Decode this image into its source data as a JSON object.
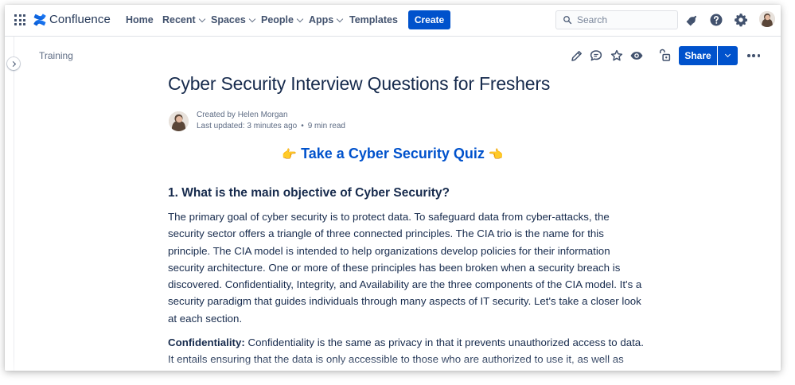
{
  "app": {
    "name": "Confluence"
  },
  "nav": {
    "items": [
      {
        "label": "Home",
        "dropdown": false
      },
      {
        "label": "Recent",
        "dropdown": true
      },
      {
        "label": "Spaces",
        "dropdown": true
      },
      {
        "label": "People",
        "dropdown": true
      },
      {
        "label": "Apps",
        "dropdown": true
      },
      {
        "label": "Templates",
        "dropdown": false
      }
    ],
    "create_label": "Create",
    "search_placeholder": "Search"
  },
  "breadcrumb": "Training",
  "page": {
    "title": "Cyber Security Interview Questions for Freshers",
    "created_by": "Created by Helen Morgan",
    "last_updated": "Last updated: 3 minutes ago",
    "separator": "•",
    "read_time": "9 min read",
    "quiz_link": "Take a Cyber Security Quiz",
    "quiz_left_emoji": "👉",
    "quiz_right_emoji": "👈",
    "question_heading": "1. What is the main objective of Cyber Security?",
    "paragraph1": "The primary goal of cyber security is to protect data. To safeguard data from cyber-attacks, the security sector offers a triangle of three connected principles. The CIA trio is the name for this principle. The CIA model is intended to help organizations develop policies for their information security architecture. One or more of these principles has been broken when a security breach is discovered. Confidentiality, Integrity, and Availability are the three components of the CIA model. It's a security paradigm that guides individuals through many aspects of IT security. Let's take a closer look at each section.",
    "paragraph2_label": "Confidentiality:",
    "paragraph2_text": " Confidentiality is the same as privacy in that it prevents unauthorized access to data. It entails ensuring that the data is only accessible to those who are authorized to use it, as well as"
  },
  "toolbar": {
    "share_label": "Share"
  },
  "colors": {
    "primary": "#0052cc",
    "text": "#172b4d",
    "subtle": "#5e6c84",
    "icon": "#42526e"
  },
  "icons": [
    "grid-icon",
    "confluence-logo-icon",
    "search-icon",
    "notifications-icon",
    "help-icon",
    "settings-icon",
    "edit-icon",
    "comment-icon",
    "star-icon",
    "watch-icon",
    "restrictions-icon",
    "more-icon",
    "chevron-right-icon"
  ]
}
